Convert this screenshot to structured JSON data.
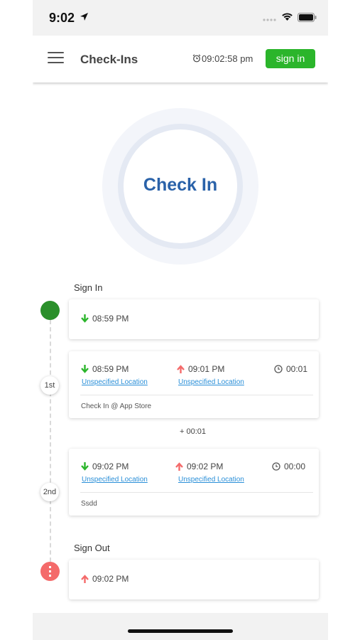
{
  "status_bar": {
    "time": "9:02"
  },
  "app_bar": {
    "title": "Check-Ins",
    "clock": "09:02:58 pm",
    "sign_in_label": "sign in"
  },
  "check_in_button": {
    "label": "Check In"
  },
  "sign_in_section": {
    "label": "Sign In",
    "time": "08:59 PM"
  },
  "entries": [
    {
      "badge": "1st",
      "in_time": "08:59 PM",
      "in_location": "Unspecified Location",
      "out_time": "09:01 PM",
      "out_location": "Unspecified Location",
      "duration": "00:01",
      "note": "Check In @ App Store"
    },
    {
      "badge": "2nd",
      "in_time": "09:02 PM",
      "in_location": "Unspecified Location",
      "out_time": "09:02 PM",
      "out_location": "Unspecified Location",
      "duration": "00:00",
      "note": "Ssdd"
    }
  ],
  "gap": {
    "text": "+ 00:01"
  },
  "sign_out_section": {
    "label": "Sign Out",
    "time": "09:02 PM"
  },
  "colors": {
    "green": "#2bb52b",
    "dot_green": "#2a8f2a",
    "red": "#f46a6a",
    "accent_blue": "#2a62a9",
    "link": "#2a8fd8"
  },
  "icons": [
    "location-arrow-icon",
    "cellular-dots-icon",
    "wifi-icon",
    "battery-icon",
    "hamburger-menu-icon",
    "alarm-clock-icon",
    "arrow-down-icon",
    "arrow-up-icon",
    "clock-icon"
  ]
}
